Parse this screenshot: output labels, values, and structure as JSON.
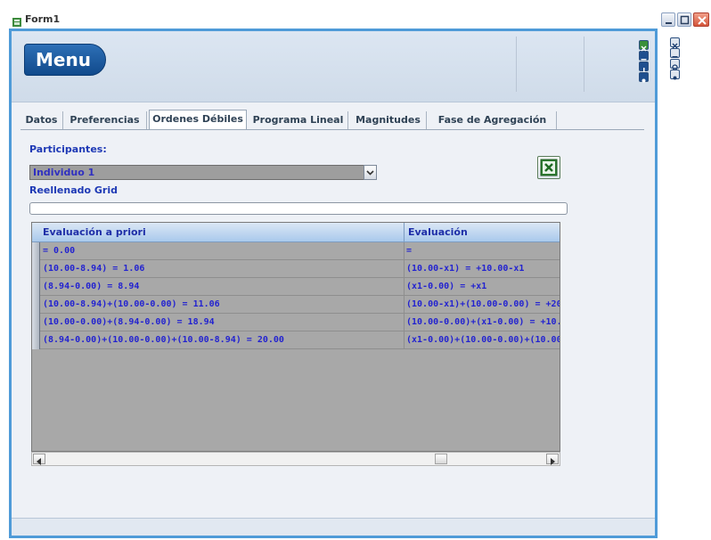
{
  "window": {
    "title": "Form1",
    "app_icon": "form-icon",
    "controls": [
      "minimize-icon",
      "maximize-icon",
      "close-icon"
    ]
  },
  "header": {
    "menu_label": "Menu",
    "mini_buttons_left": [
      "excel-icon",
      "minus-icon",
      "info-icon",
      "gear-icon"
    ],
    "mini_buttons_right": [
      "close-icon",
      "minus-icon",
      "refresh-icon",
      "gear-icon"
    ]
  },
  "tabs": [
    {
      "label": "Datos"
    },
    {
      "label": "Preferencias"
    },
    {
      "label": "Ordenes Débiles"
    },
    {
      "label": "Programa Lineal"
    },
    {
      "label": "Magnitudes"
    },
    {
      "label": "Fase de Agregación"
    }
  ],
  "active_tab": "Ordenes Débiles",
  "participants": {
    "label": "Participantes:",
    "selected": "Individuo 1"
  },
  "fill_grid_label": "Reellenado Grid",
  "progress": 0,
  "grid": {
    "columns": [
      "Evaluación a priori",
      "Evaluación"
    ],
    "rows": [
      [
        "= 0.00",
        "="
      ],
      [
        "(10.00-8.94) = 1.06",
        "(10.00-x1) = +10.00-x1"
      ],
      [
        "(8.94-0.00) = 8.94",
        "(x1-0.00) = +x1"
      ],
      [
        "(10.00-8.94)+(10.00-0.00) = 11.06",
        "(10.00-x1)+(10.00-0.00) = +20.0("
      ],
      [
        "(10.00-0.00)+(8.94-0.00) = 18.94",
        "(10.00-0.00)+(x1-0.00) = +10.00-"
      ],
      [
        "(8.94-0.00)+(10.00-0.00)+(10.00-8.94) = 20.00",
        "(x1-0.00)+(10.00-0.00)+(10.00-x'"
      ]
    ]
  },
  "colors": {
    "frame_border": "#4f9bd8",
    "header_band": "#d4dfec",
    "menu_pill": "#1f5ea3",
    "grid_background": "#a8a8a8",
    "grid_text": "#2323d0",
    "label_text": "#1e39b5"
  }
}
